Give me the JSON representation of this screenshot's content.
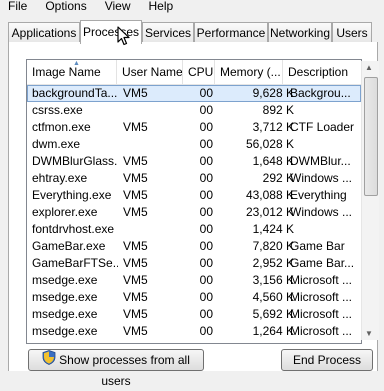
{
  "menu": [
    "File",
    "Options",
    "View",
    "Help"
  ],
  "tabs": [
    "Applications",
    "Processes",
    "Services",
    "Performance",
    "Networking",
    "Users"
  ],
  "active_tab": "Processes",
  "columns": [
    "Image Name",
    "User Name",
    "CPU",
    "Memory (...",
    "Description"
  ],
  "processes": [
    {
      "name": "backgroundTa...",
      "user": "VM5",
      "cpu": "00",
      "memory": "9,628 K",
      "description": "Backgrou..."
    },
    {
      "name": "csrss.exe",
      "user": "",
      "cpu": "00",
      "memory": "892 K",
      "description": ""
    },
    {
      "name": "ctfmon.exe",
      "user": "VM5",
      "cpu": "00",
      "memory": "3,712 K",
      "description": "CTF Loader"
    },
    {
      "name": "dwm.exe",
      "user": "",
      "cpu": "00",
      "memory": "56,028 K",
      "description": ""
    },
    {
      "name": "DWMBlurGlass...",
      "user": "VM5",
      "cpu": "00",
      "memory": "1,648 K",
      "description": "DWMBlur..."
    },
    {
      "name": "ehtray.exe",
      "user": "VM5",
      "cpu": "00",
      "memory": "292 K",
      "description": "Windows ..."
    },
    {
      "name": "Everything.exe",
      "user": "VM5",
      "cpu": "00",
      "memory": "43,088 K",
      "description": "Everything"
    },
    {
      "name": "explorer.exe",
      "user": "VM5",
      "cpu": "00",
      "memory": "23,012 K",
      "description": "Windows ..."
    },
    {
      "name": "fontdrvhost.exe",
      "user": "",
      "cpu": "00",
      "memory": "1,424 K",
      "description": ""
    },
    {
      "name": "GameBar.exe",
      "user": "VM5",
      "cpu": "00",
      "memory": "7,820 K",
      "description": "Game Bar"
    },
    {
      "name": "GameBarFTSe...",
      "user": "VM5",
      "cpu": "00",
      "memory": "2,952 K",
      "description": "Game Bar..."
    },
    {
      "name": "msedge.exe",
      "user": "VM5",
      "cpu": "00",
      "memory": "3,156 K",
      "description": "Microsoft ..."
    },
    {
      "name": "msedge.exe",
      "user": "VM5",
      "cpu": "00",
      "memory": "4,560 K",
      "description": "Microsoft ..."
    },
    {
      "name": "msedge.exe",
      "user": "VM5",
      "cpu": "00",
      "memory": "5,692 K",
      "description": "Microsoft ..."
    },
    {
      "name": "msedge.exe",
      "user": "VM5",
      "cpu": "00",
      "memory": "1,264 K",
      "description": "Microsoft ..."
    }
  ],
  "buttons": {
    "show_all": "Show processes from all users",
    "end_process": "End Process"
  },
  "colors": {
    "selected_row": "#dcebfc",
    "selected_border": "#7da2ce"
  },
  "icons": {
    "shield": "uac-shield-icon",
    "cursor": "mouse-pointer-icon"
  }
}
